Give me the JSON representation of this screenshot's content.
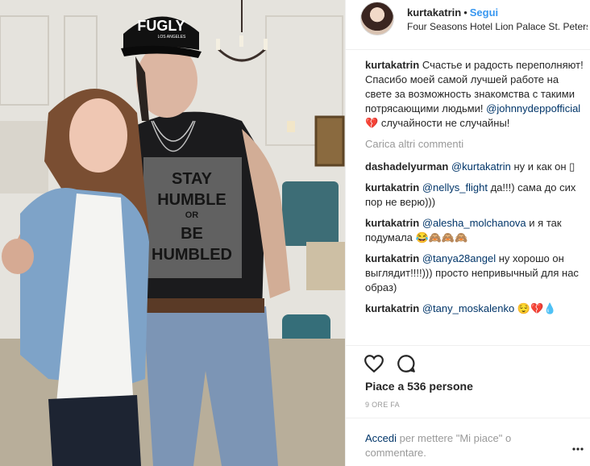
{
  "post": {
    "username": "kurtakatrin",
    "separator": "•",
    "follow_label": "Segui",
    "location": "Four Seasons Hotel Lion Palace St. Petersb."
  },
  "photo": {
    "cap_text": "FUGLY",
    "cap_subtext": "LOS ANGELES",
    "shirt_lines": [
      "STAY",
      "HUMBLE",
      "OR",
      "BE",
      "HUMBLED"
    ]
  },
  "caption": {
    "user": "kurtakatrin",
    "text": "Счастье и радость переполняют! Спасибо моей самой лучшей работе на свете за возможность знакомства с такими потрясающими людьми!",
    "mention": "@johnnydeppofficial",
    "emoji": "💔",
    "text_end": "случайности не случайны!"
  },
  "load_more_label": "Carica altri commenti",
  "comments": [
    {
      "user": "dashadelyurman",
      "mention": "@kurtakatrin",
      "text": "ну и как он ▯"
    },
    {
      "user": "kurtakatrin",
      "mention": "@nellys_flight",
      "text": "да!!!) сама до сих пор не верю)))"
    },
    {
      "user": "kurtakatrin",
      "mention": "@alesha_molchanova",
      "text": "и я так подумала 😂🙈🙈🙈"
    },
    {
      "user": "kurtakatrin",
      "mention": "@tanya28angel",
      "text": "ну хорошо он выглядит!!!!))) просто непривычный для нас образ)"
    },
    {
      "user": "kurtakatrin",
      "mention": "@tany_moskalenko",
      "text": "😌💔💧"
    }
  ],
  "actions": {
    "like_icon": "heart-outline-icon",
    "comment_icon": "speech-bubble-icon"
  },
  "likes_label": "Piace a 536 persone",
  "time_label": "9 ORE FA",
  "login": {
    "link": "Accedi",
    "text": " per mettere \"Mi piace\" o commentare."
  },
  "colors": {
    "link": "#003569",
    "follow": "#3897f0",
    "muted": "#999999"
  }
}
